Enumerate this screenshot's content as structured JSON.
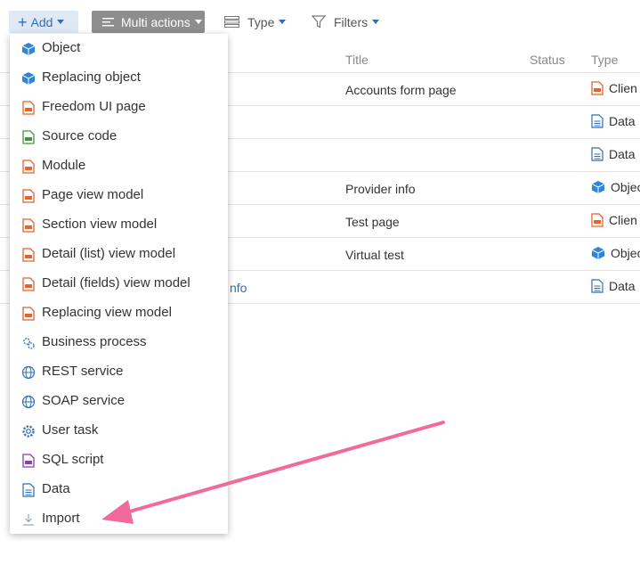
{
  "toolbar": {
    "add_label": "Add",
    "multi_label": "Multi actions",
    "type_label": "Type",
    "filters_label": "Filters"
  },
  "grid": {
    "columns": [
      "Title",
      "Status",
      "Type"
    ],
    "rows": [
      {
        "title": "Accounts form page",
        "type": "Clien",
        "type_icon": "client-module-icon"
      },
      {
        "title": "",
        "type": "Data",
        "type_icon": "data-icon"
      },
      {
        "title": "",
        "type": "Data",
        "type_icon": "data-icon"
      },
      {
        "title": "Provider info",
        "type": "Objec",
        "type_icon": "object-icon"
      },
      {
        "title": "Test page",
        "type": "Clien",
        "type_icon": "client-module-icon"
      },
      {
        "title": "Virtual test",
        "type": "Objec",
        "type_icon": "object-icon"
      },
      {
        "title": "",
        "name_fragment": "nfo",
        "type": "Data",
        "type_icon": "data-icon"
      }
    ]
  },
  "menu": {
    "items": [
      {
        "label": "Object",
        "icon": "object-icon"
      },
      {
        "label": "Replacing object",
        "icon": "object-icon"
      },
      {
        "label": "Freedom UI page",
        "icon": "js-file-icon"
      },
      {
        "label": "Source code",
        "icon": "source-code-icon"
      },
      {
        "label": "Module",
        "icon": "js-file-icon"
      },
      {
        "label": "Page view model",
        "icon": "js-file-icon"
      },
      {
        "label": "Section view model",
        "icon": "js-file-icon"
      },
      {
        "label": "Detail (list) view model",
        "icon": "js-file-icon"
      },
      {
        "label": "Detail (fields) view model",
        "icon": "js-file-icon"
      },
      {
        "label": "Replacing view model",
        "icon": "js-file-icon"
      },
      {
        "label": "Business process",
        "icon": "process-icon"
      },
      {
        "label": "REST service",
        "icon": "globe-icon"
      },
      {
        "label": "SOAP service",
        "icon": "globe-icon"
      },
      {
        "label": "User task",
        "icon": "gear-icon"
      },
      {
        "label": "SQL script",
        "icon": "sql-icon"
      },
      {
        "label": "Data",
        "icon": "data-icon"
      },
      {
        "label": "Import",
        "icon": "download-icon"
      }
    ]
  },
  "colors": {
    "accent": "#2f6db5",
    "orange_file": "#e8622b",
    "green_file": "#3a9a3a",
    "purple_file": "#8a3fb5",
    "annotation_arrow": "#f06a9b"
  }
}
